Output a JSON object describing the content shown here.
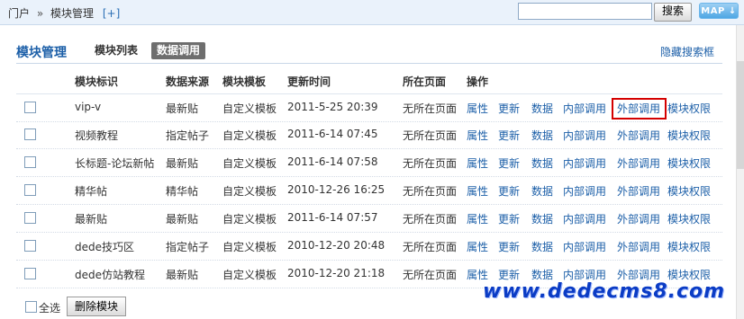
{
  "breadcrumb": {
    "home": "门户",
    "separator": "»",
    "current": "模块管理",
    "add": "[+]"
  },
  "search": {
    "value": "",
    "button": "搜索",
    "map_button": "MAP"
  },
  "header": {
    "title": "模块管理",
    "tab_list": "模块列表",
    "tab_data": "数据调用",
    "hide_search": "隐藏搜索框"
  },
  "table": {
    "columns": [
      "模块标识",
      "数据来源",
      "模块模板",
      "更新时间",
      "所在页面",
      "操作"
    ],
    "actions": [
      "属性",
      "更新",
      "数据",
      "内部调用",
      "外部调用",
      "模块权限"
    ],
    "rows": [
      {
        "name": "vip-v",
        "source": "最新贴",
        "template": "自定义模板",
        "time": "2011-5-25 20:39",
        "page": "无所在页面"
      },
      {
        "name": "视频教程",
        "source": "指定帖子",
        "template": "自定义模板",
        "time": "2011-6-14 07:45",
        "page": "无所在页面"
      },
      {
        "name": "长标题-论坛新帖",
        "source": "最新贴",
        "template": "自定义模板",
        "time": "2011-6-14 07:58",
        "page": "无所在页面"
      },
      {
        "name": "精华帖",
        "source": "精华帖",
        "template": "自定义模板",
        "time": "2010-12-26 16:25",
        "page": "无所在页面"
      },
      {
        "name": "最新贴",
        "source": "最新贴",
        "template": "自定义模板",
        "time": "2011-6-14 07:57",
        "page": "无所在页面"
      },
      {
        "name": "dede技巧区",
        "source": "指定帖子",
        "template": "自定义模板",
        "time": "2010-12-20 20:48",
        "page": "无所在页面"
      },
      {
        "name": "dede仿站教程",
        "source": "最新贴",
        "template": "自定义模板",
        "time": "2010-12-20 21:18",
        "page": "无所在页面"
      }
    ]
  },
  "footer": {
    "select_all": "全选",
    "delete_button": "删除模块"
  },
  "watermark": "www.dedecms8.com",
  "colors": {
    "link": "#1c5fa8",
    "highlight": "#d40000",
    "topbar": "#eaf2fb"
  }
}
